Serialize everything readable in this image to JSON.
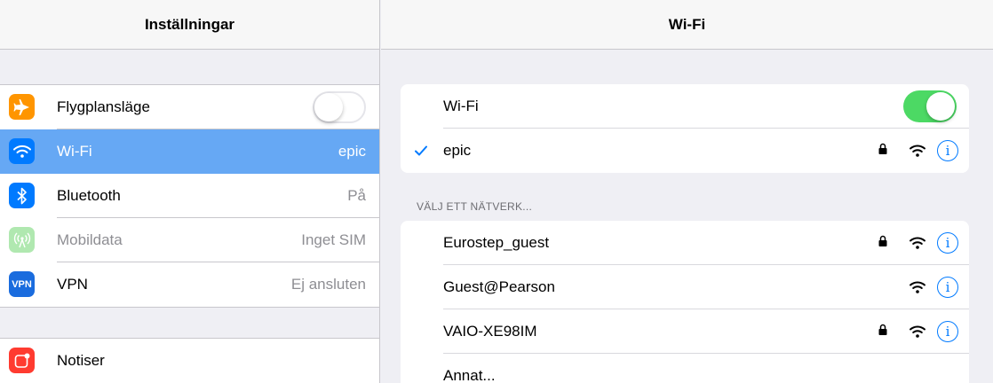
{
  "left": {
    "title": "Inställningar",
    "items": [
      {
        "label": "Flygplansläge",
        "icon": "airplane-icon",
        "icon_color": "#ff9500",
        "toggle": false
      },
      {
        "label": "Wi-Fi",
        "icon": "wifi-icon",
        "icon_color": "#007aff",
        "value": "epic",
        "selected": true
      },
      {
        "label": "Bluetooth",
        "icon": "bluetooth-icon",
        "icon_color": "#007aff",
        "value": "På"
      },
      {
        "label": "Mobildata",
        "icon": "cellular-icon",
        "icon_color": "#b0e8b0",
        "value": "Inget SIM",
        "disabled": true
      },
      {
        "label": "VPN",
        "icon": "vpn-icon",
        "icon_color": "#1a6cde",
        "icon_text": "VPN",
        "value": "Ej ansluten"
      }
    ],
    "items2": [
      {
        "label": "Notiser",
        "icon": "notifications-icon",
        "icon_color": "#ff3b30"
      }
    ]
  },
  "right": {
    "title": "Wi-Fi",
    "wifi_label": "Wi-Fi",
    "wifi_on": true,
    "connected": {
      "name": "epic",
      "locked": true
    },
    "section": "VÄLJ ETT NÄTVERK...",
    "networks": [
      {
        "name": "Eurostep_guest",
        "locked": true
      },
      {
        "name": "Guest@Pearson",
        "locked": false
      },
      {
        "name": "VAIO-XE98IM",
        "locked": true
      }
    ],
    "other": "Annat...",
    "info_glyph": "i",
    "accent": "#007aff",
    "toggle_on_color": "#4cd964"
  }
}
